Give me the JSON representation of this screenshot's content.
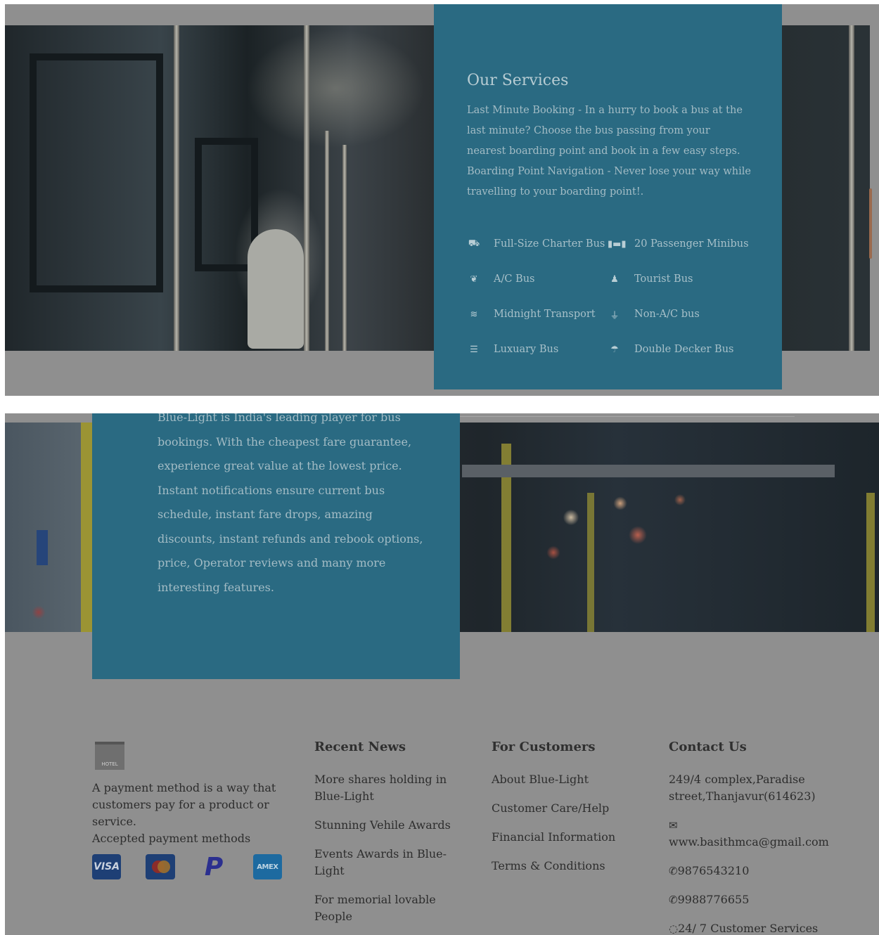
{
  "services": {
    "title": "Our Services",
    "description": "Last Minute Booking - In a hurry to book a bus at the last minute? Choose the bus passing from your nearest boarding point and book in a few easy steps. Boarding Point Navigation - Never lose your way while travelling to your boarding point!.",
    "items": [
      {
        "label": "Full-Size Charter Bus",
        "icon": "bus-icon"
      },
      {
        "label": "20 Passenger Minibus",
        "icon": "dumbbell-icon"
      },
      {
        "label": "A/C Bus",
        "icon": "spa-icon"
      },
      {
        "label": "Tourist Bus",
        "icon": "bell-icon"
      },
      {
        "label": "Midnight Transport",
        "icon": "swimmer-icon"
      },
      {
        "label": "Non-A/C bus",
        "icon": "microphone-icon"
      },
      {
        "label": "Luxuary Bus",
        "icon": "waves-icon"
      },
      {
        "label": "Double Decker Bus",
        "icon": "umbrella-beach-icon"
      }
    ]
  },
  "about": {
    "text": "Blue-Light is India's leading player for bus bookings. With the cheapest fare guarantee, experience great value at the lowest price. Instant notifications ensure current bus schedule, instant fare drops, amazing discounts, instant refunds and rebook options, price, Operator reviews and many more interesting features."
  },
  "footer": {
    "logo_text": "HOTEL",
    "about_text": "A payment method is a way that customers pay for a product or service.",
    "payments_label": "Accepted payment methods",
    "payments": {
      "visa": "VISA",
      "paypal": "P",
      "amex": "AMEX"
    },
    "news": {
      "title": "Recent News",
      "items": [
        "More shares holding in Blue-Light",
        "Stunning Vehile Awards",
        "Events Awards in Blue-Light",
        "For memorial lovable People"
      ]
    },
    "customers": {
      "title": "For Customers",
      "items": [
        "About Blue-Light",
        "Customer Care/Help",
        "Financial Information",
        "Terms & Conditions"
      ]
    },
    "contact": {
      "title": "Contact Us",
      "address": "249/4 complex,Paradise street,Thanjavur(614623)",
      "email": "www.basithmca@gmail.com",
      "phone1": "9876543210",
      "phone2": "9988776655",
      "service": "24/ 7 Customer Services"
    }
  },
  "colors": {
    "card": "#2a6a82",
    "overlay": "#8f8f8f",
    "scroll_thumb": "#9a6a4e"
  }
}
